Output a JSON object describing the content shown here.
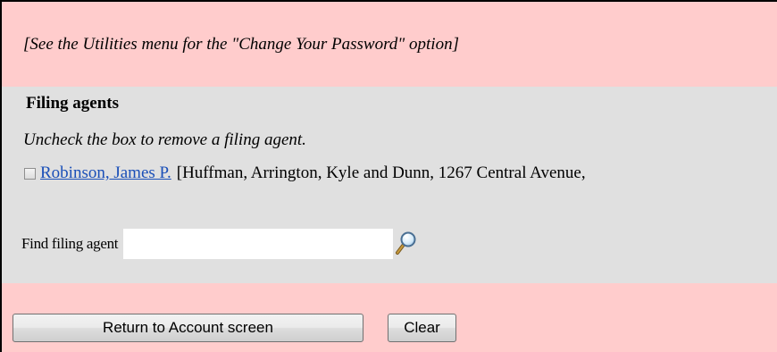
{
  "note": "[See the Utilities menu for the \"Change Your Password\" option]",
  "filing_agents": {
    "title": "Filing agents",
    "hint": "Uncheck the box to remove a filing agent.",
    "agents": [
      {
        "name": "Robinson, James P.",
        "detail": "[Huffman, Arrington, Kyle and Dunn, 1267 Central Avenue,",
        "checked": false
      }
    ],
    "find_label": "Find filing agent",
    "find_value": "",
    "search_icon": "magnifier-icon"
  },
  "buttons": {
    "return_label": "Return to Account screen",
    "clear_label": "Clear"
  },
  "colors": {
    "page_background": "#ffcccc",
    "section_background": "#e0e0e0",
    "link": "#1a4fb8"
  }
}
